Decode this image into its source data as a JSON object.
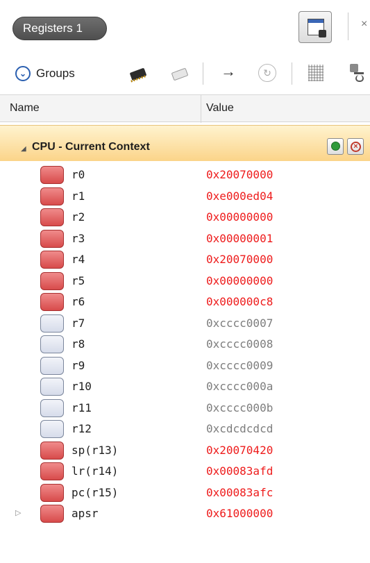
{
  "window": {
    "tab_title": "Registers 1",
    "close_glyph": "×"
  },
  "toolbar": {
    "groups_label": "Groups",
    "icons": [
      "view-mode-icon",
      "chip-dark-icon",
      "chip-light-icon",
      "arrow-right-icon",
      "refresh-icon",
      "grid-icon",
      "add-watch-icon"
    ]
  },
  "columns": {
    "name": "Name",
    "value": "Value"
  },
  "group": {
    "label": "CPU - Current Context",
    "expanded": true
  },
  "colors": {
    "modified_value": "#ee1b1b",
    "unchanged_value": "#7d7d7d",
    "group_header": "#fbd489"
  },
  "registers": [
    {
      "name": "r0",
      "value": "0x20070000",
      "modified": true
    },
    {
      "name": "r1",
      "value": "0xe000ed04",
      "modified": true
    },
    {
      "name": "r2",
      "value": "0x00000000",
      "modified": true
    },
    {
      "name": "r3",
      "value": "0x00000001",
      "modified": true
    },
    {
      "name": "r4",
      "value": "0x20070000",
      "modified": true
    },
    {
      "name": "r5",
      "value": "0x00000000",
      "modified": true
    },
    {
      "name": "r6",
      "value": "0x000000c8",
      "modified": true
    },
    {
      "name": "r7",
      "value": "0xcccc0007",
      "modified": false
    },
    {
      "name": "r8",
      "value": "0xcccc0008",
      "modified": false
    },
    {
      "name": "r9",
      "value": "0xcccc0009",
      "modified": false
    },
    {
      "name": "r10",
      "value": "0xcccc000a",
      "modified": false
    },
    {
      "name": "r11",
      "value": "0xcccc000b",
      "modified": false
    },
    {
      "name": "r12",
      "value": "0xcdcdcdcd",
      "modified": false
    },
    {
      "name": "sp(r13)",
      "value": "0x20070420",
      "modified": true
    },
    {
      "name": "lr(r14)",
      "value": "0x00083afd",
      "modified": true
    },
    {
      "name": "pc(r15)",
      "value": "0x00083afc",
      "modified": true
    },
    {
      "name": "apsr",
      "value": "0x61000000",
      "modified": true,
      "expandable": true
    }
  ]
}
